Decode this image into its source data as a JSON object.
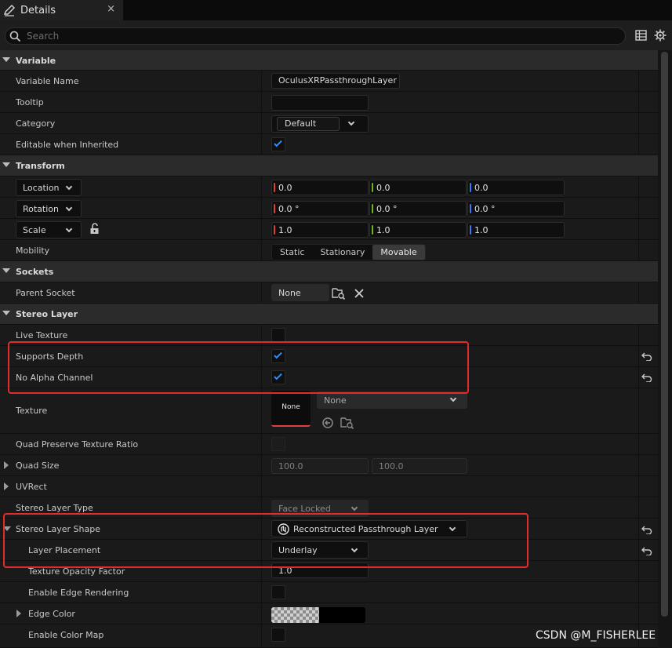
{
  "tab": {
    "title": "Details",
    "close": "×",
    "icon": "pencil-icon"
  },
  "search": {
    "placeholder": "Search"
  },
  "toolbar": {
    "table_icon": "table-view-icon",
    "settings_icon": "gear-icon"
  },
  "categories": {
    "variable": "Variable",
    "transform": "Transform",
    "sockets": "Sockets",
    "stereo_layer": "Stereo Layer"
  },
  "variable": {
    "name_label": "Variable Name",
    "name_value": "OculusXRPassthroughLayer",
    "tooltip_label": "Tooltip",
    "tooltip_value": "",
    "category_label": "Category",
    "category_value": "Default",
    "editable_label": "Editable when Inherited",
    "editable_checked": true
  },
  "transform": {
    "location_label": "Location",
    "location": [
      "0.0",
      "0.0",
      "0.0"
    ],
    "rotation_label": "Rotation",
    "rotation": [
      "0.0 °",
      "0.0 °",
      "0.0 °"
    ],
    "scale_label": "Scale",
    "scale": [
      "1.0",
      "1.0",
      "1.0"
    ],
    "mobility_label": "Mobility",
    "mobility_options": [
      "Static",
      "Stationary",
      "Movable"
    ],
    "mobility_selected": "Movable",
    "axis_colors": [
      "#e0403a",
      "#6fb523",
      "#3b7cf0"
    ]
  },
  "sockets": {
    "parent_label": "Parent Socket",
    "parent_value": "None"
  },
  "stereo": {
    "live_texture_label": "Live Texture",
    "supports_depth_label": "Supports Depth",
    "no_alpha_label": "No Alpha Channel",
    "texture_label": "Texture",
    "texture_thumb": "None",
    "texture_value": "None",
    "quad_ratio_label": "Quad Preserve Texture Ratio",
    "quad_size_label": "Quad Size",
    "quad_size": [
      "100.0",
      "100.0"
    ],
    "uvrect_label": "UVRect",
    "layer_type_label": "Stereo Layer Type",
    "layer_type_value": "Face Locked",
    "layer_shape_label": "Stereo Layer Shape",
    "layer_shape_value": "Reconstructed Passthrough Layer",
    "layer_placement_label": "Layer Placement",
    "layer_placement_value": "Underlay",
    "opacity_label": "Texture Opacity Factor",
    "opacity_value": "1.0",
    "edge_rendering_label": "Enable Edge Rendering",
    "edge_color_label": "Edge Color",
    "color_map_label": "Enable Color Map"
  },
  "watermark": "CSDN @M_FISHERLEE",
  "highlight_color": "#e22b2b"
}
